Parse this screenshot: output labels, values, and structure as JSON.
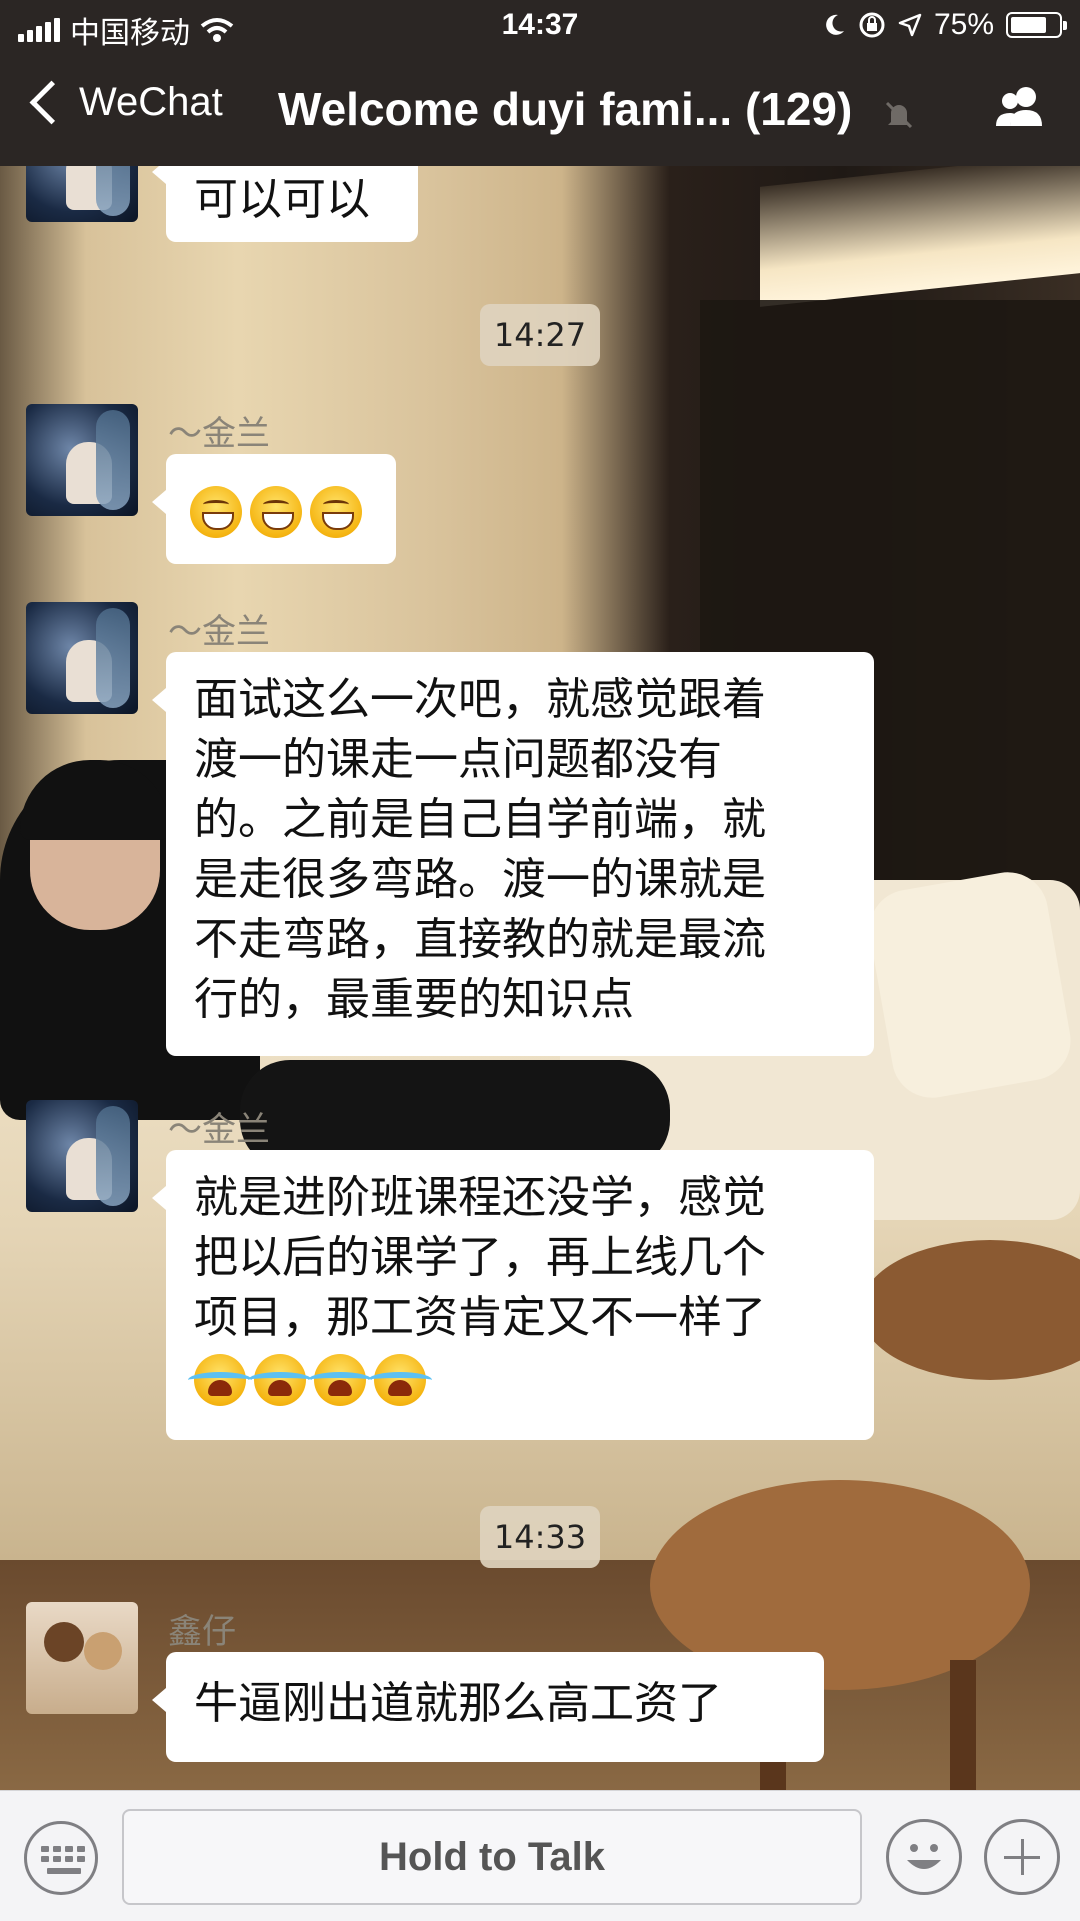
{
  "status_bar": {
    "carrier": "中国移动",
    "time": "14:37",
    "battery_percent": "75%",
    "battery_level": 0.75
  },
  "nav": {
    "back_label": "WeChat",
    "title": "Welcome duyi fami... (129)"
  },
  "timestamps": [
    "14:27",
    "14:33"
  ],
  "messages": [
    {
      "sender": "",
      "text": "可以可以"
    },
    {
      "sender": "～金兰",
      "emoji": [
        "grin",
        "grin",
        "grin"
      ]
    },
    {
      "sender": "～金兰",
      "lines": [
        "面试这么一次吧，就感觉跟着",
        "渡一的课走一点问题都没有",
        "的。之前是自己自学前端，就",
        "是走很多弯路。渡一的课就是",
        "不走弯路，直接教的就是最流",
        "行的，最重要的知识点"
      ]
    },
    {
      "sender": "～金兰",
      "lines": [
        "就是进阶班课程还没学，感觉",
        "把以后的课学了，再上线几个",
        "项目，那工资肯定又不一样了"
      ],
      "emoji": [
        "cry",
        "cry",
        "cry",
        "cry"
      ]
    },
    {
      "sender": "鑫仔",
      "text": "牛逼刚出道就那么高工资了"
    }
  ],
  "input_bar": {
    "hold_to_talk": "Hold to Talk"
  },
  "colors": {
    "bar_bg": "#2b2624",
    "bubble_bg": "#ffffff",
    "timestamp_bg": "#ded2be"
  }
}
